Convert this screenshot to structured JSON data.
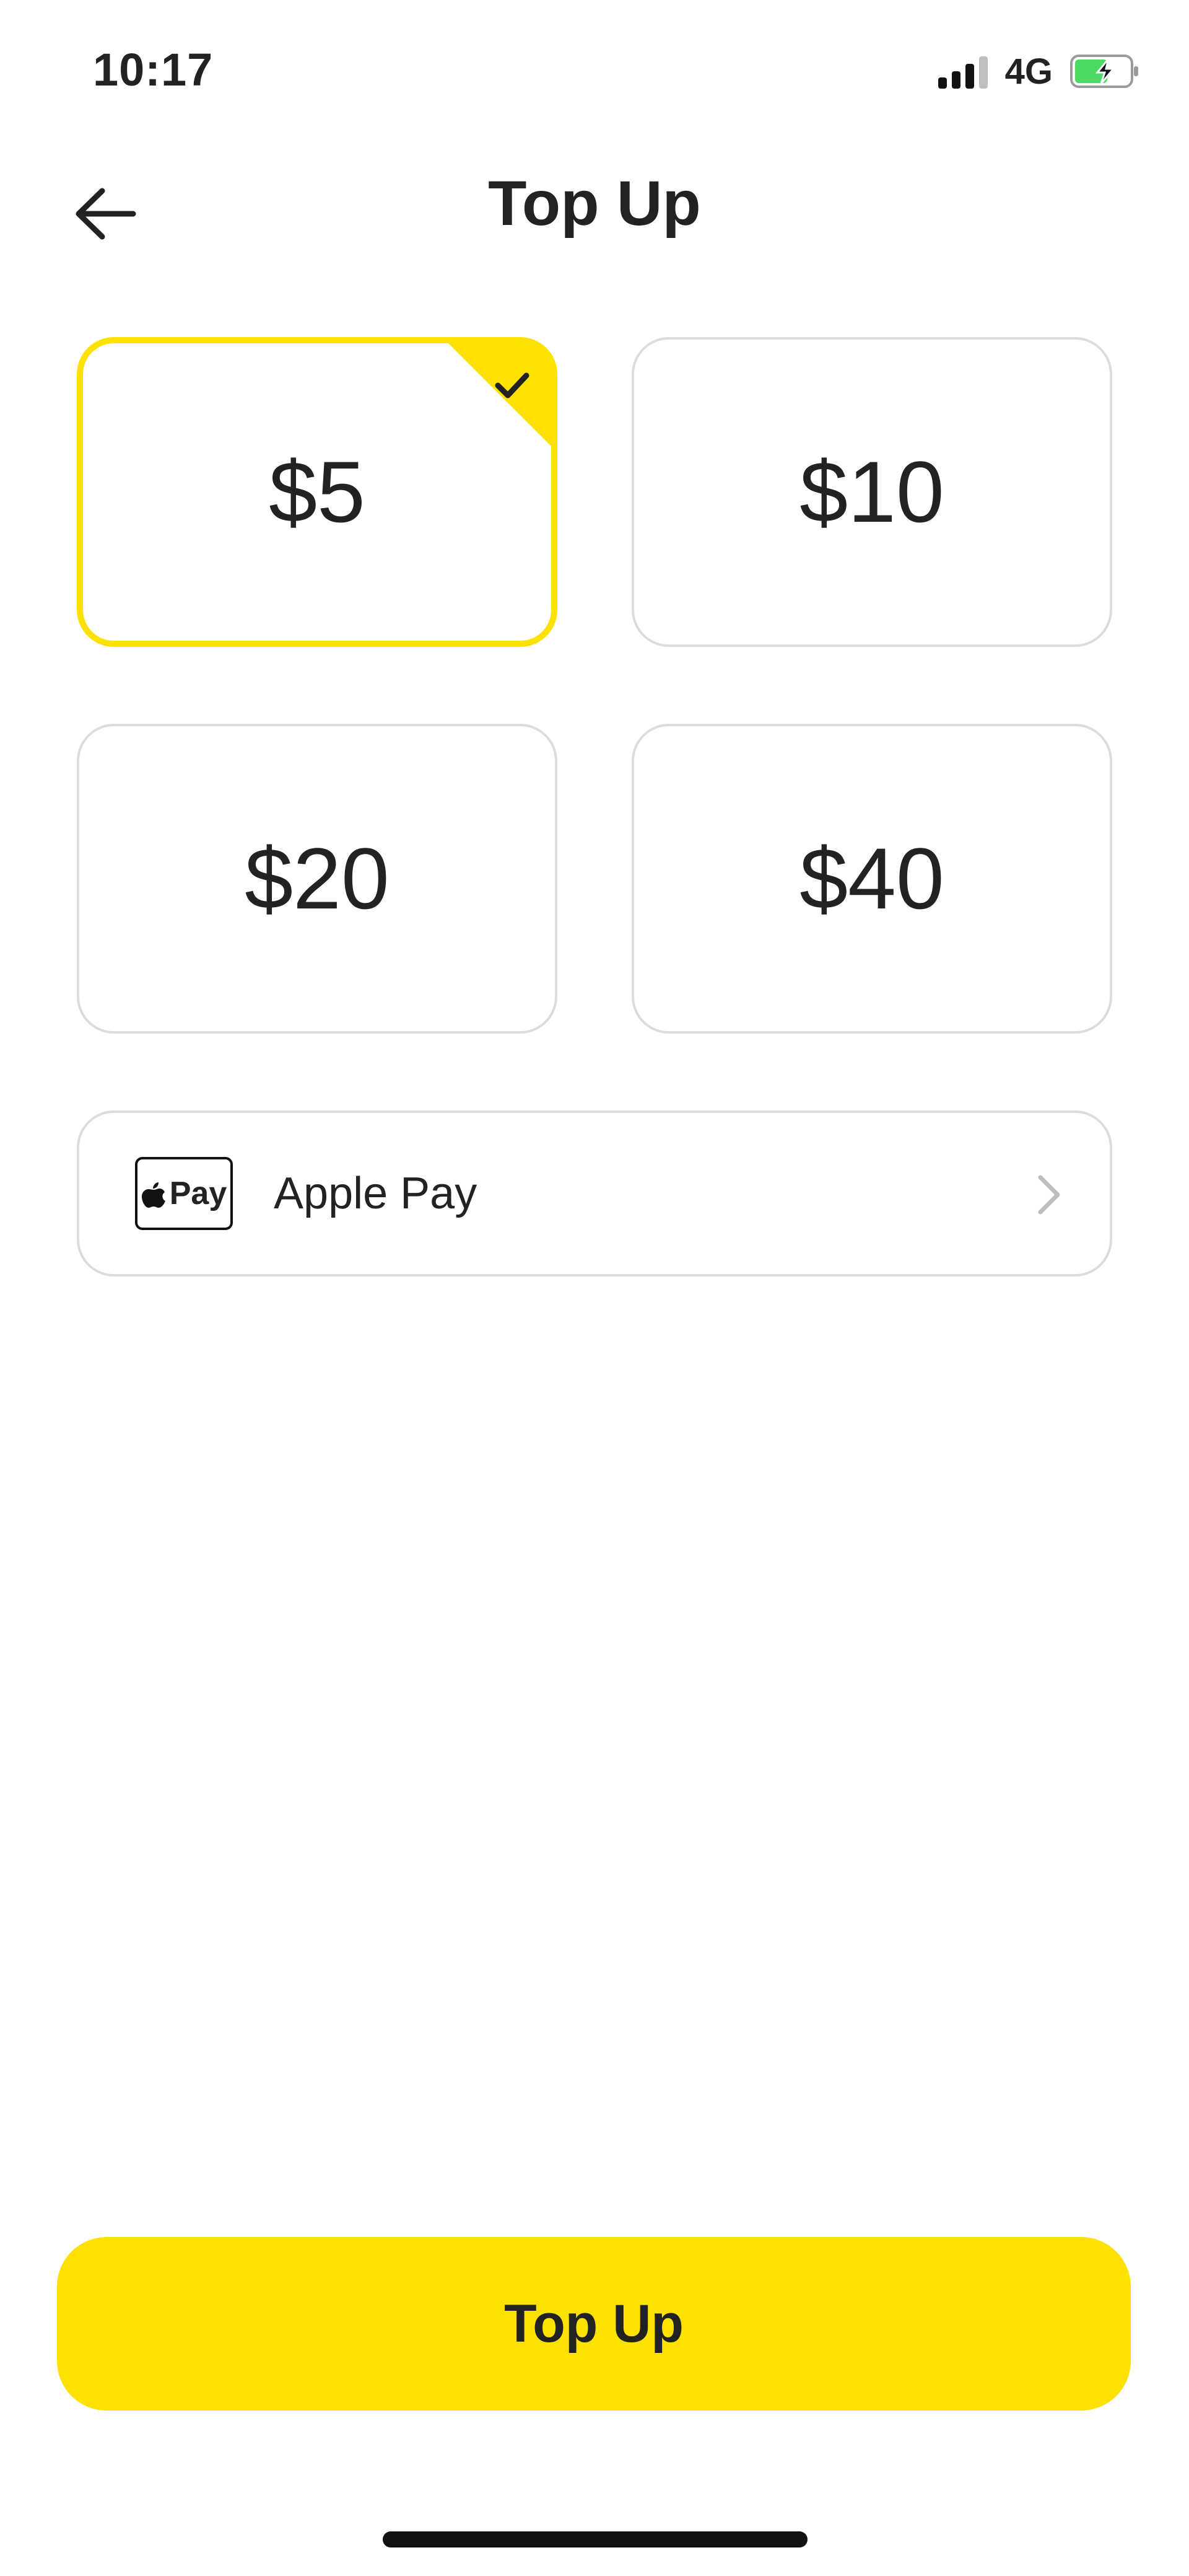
{
  "status_bar": {
    "time": "10:17",
    "network": "4G",
    "icons": [
      "signal-icon",
      "battery-charging-icon"
    ]
  },
  "header": {
    "title": "Top Up",
    "back_icon": "arrow-left-icon"
  },
  "amounts": [
    {
      "label": "$5",
      "selected": true
    },
    {
      "label": "$10",
      "selected": false
    },
    {
      "label": "$20",
      "selected": false
    },
    {
      "label": "$40",
      "selected": false
    }
  ],
  "payment": {
    "logo_text": "Pay",
    "label": "Apple Pay",
    "icon": "chevron-right-icon"
  },
  "primary_button": {
    "label": "Top Up"
  },
  "colors": {
    "accent": "#FDE100",
    "border": "#DCDCDC",
    "text": "#222222",
    "battery_green": "#4CD964"
  }
}
